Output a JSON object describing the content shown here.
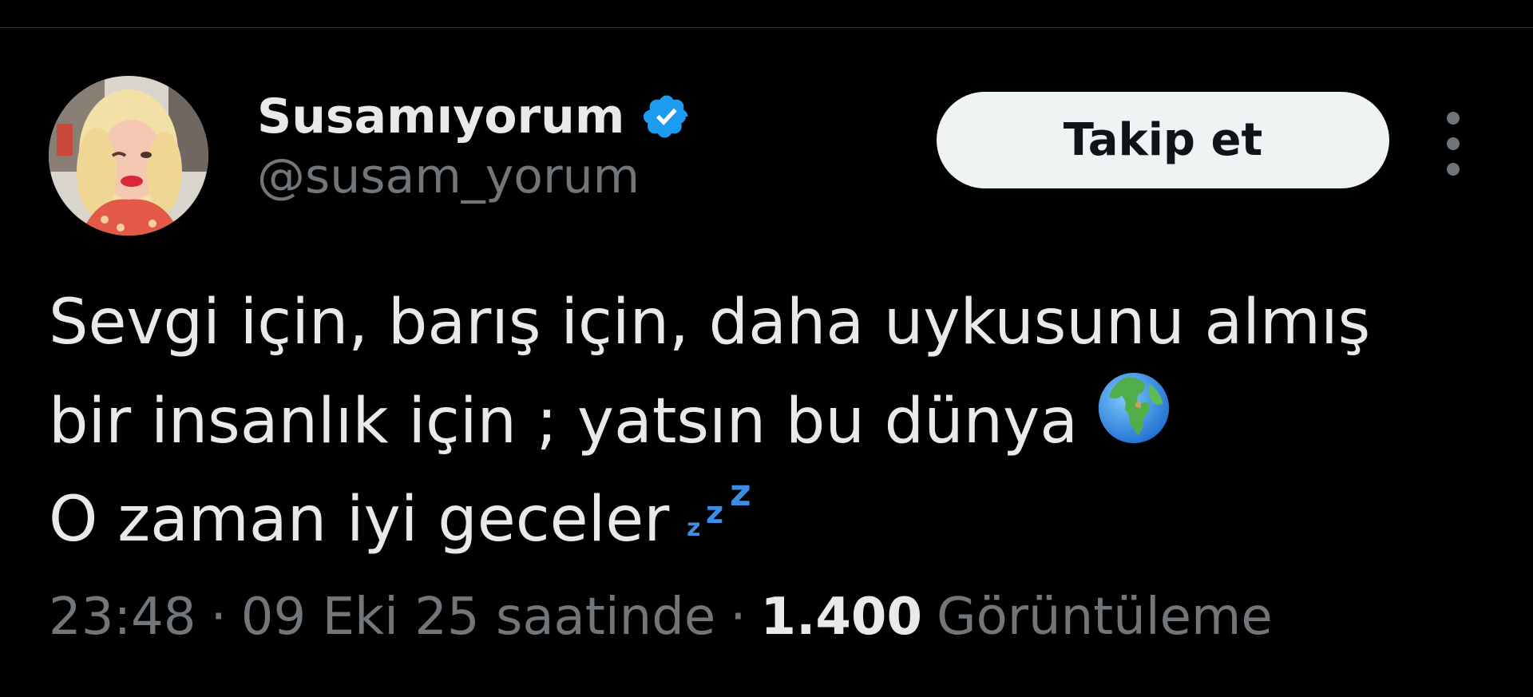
{
  "author": {
    "display_name": "Susamıyorum",
    "handle": "@susam_yorum",
    "verified_icon": "verified-badge-icon",
    "avatar_icon": "profile-avatar"
  },
  "actions": {
    "follow_label": "Takip et",
    "more_icon": "more-options-icon"
  },
  "tweet": {
    "lines": [
      "Sevgi için, barış için, daha uykusunu almış",
      "bir insanlık için ; yatsın bu dünya",
      "O zaman iyi geceler"
    ],
    "emoji_globe": "globe-emoji",
    "emoji_sleep": "zzz-emoji"
  },
  "meta": {
    "time": "23:48",
    "date_text": "09 Eki 25 saatinde",
    "separator": "·",
    "views_count": "1.400",
    "views_label": "Görüntüleme"
  },
  "colors": {
    "background": "#000000",
    "text_primary": "#e7e9ea",
    "text_secondary": "#71767b",
    "verified_blue": "#1d9bf0",
    "button_bg": "#eff3f4"
  }
}
